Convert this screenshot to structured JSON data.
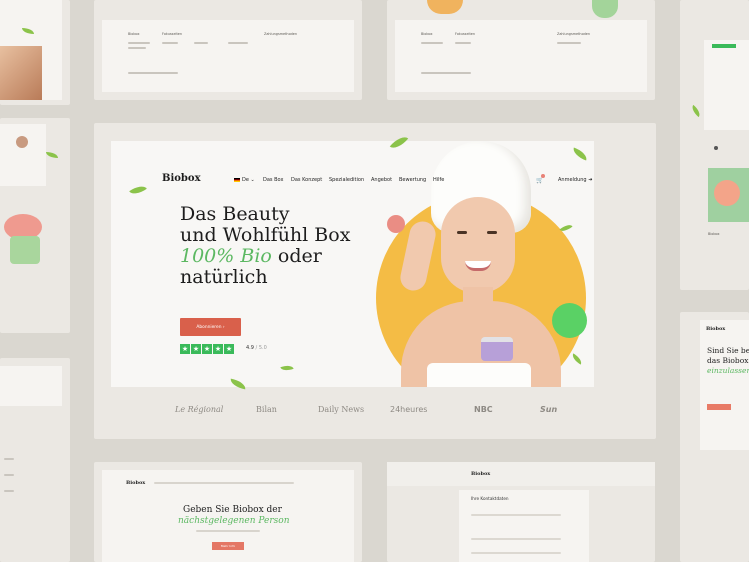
{
  "brand": "Biobox",
  "language": "De",
  "nav": [
    "Das Box",
    "Das Konzept",
    "Spezialedition",
    "Angebot",
    "Bewertung",
    "Hilfe"
  ],
  "login": "Anmeldung",
  "hero": {
    "line1": "Das Beauty",
    "line2": "und Wohlfühl Box",
    "line3_green": "100% Bio",
    "line3_rest": "oder",
    "line4": "natürlich",
    "cta": "Abonnieren",
    "rating": "4.9",
    "rating_max": "/ 5.0"
  },
  "press_logos": [
    "Le Régional",
    "Bilan",
    "Daily News",
    "24heures",
    "NBC",
    "Sun"
  ],
  "secondary": {
    "bottom_left_title_1": "Geben Sie Biobox der",
    "bottom_left_title_2": "nächstgelegenen Person",
    "bottom_left_cta": "Mehr Info",
    "bottom_mid_brand": "Biobox",
    "bottom_mid_form_title": "Ihre Kontaktdaten",
    "right_brand": "Biobox",
    "right_title_1": "Sind Sie ber",
    "right_title_2": "das Biobox",
    "right_title_3": "einzulassen",
    "footer_col1": "Biobox",
    "footer_col2": "Fokusseiten",
    "footer_col3": "Zahlungsmethoden",
    "right_label": "Biobox"
  },
  "colors": {
    "accent_green": "#5cb862",
    "cta_red": "#d9604b",
    "yellow": "#f4bc45",
    "pink": "#ea8d84",
    "trust_green": "#3aba5a"
  }
}
